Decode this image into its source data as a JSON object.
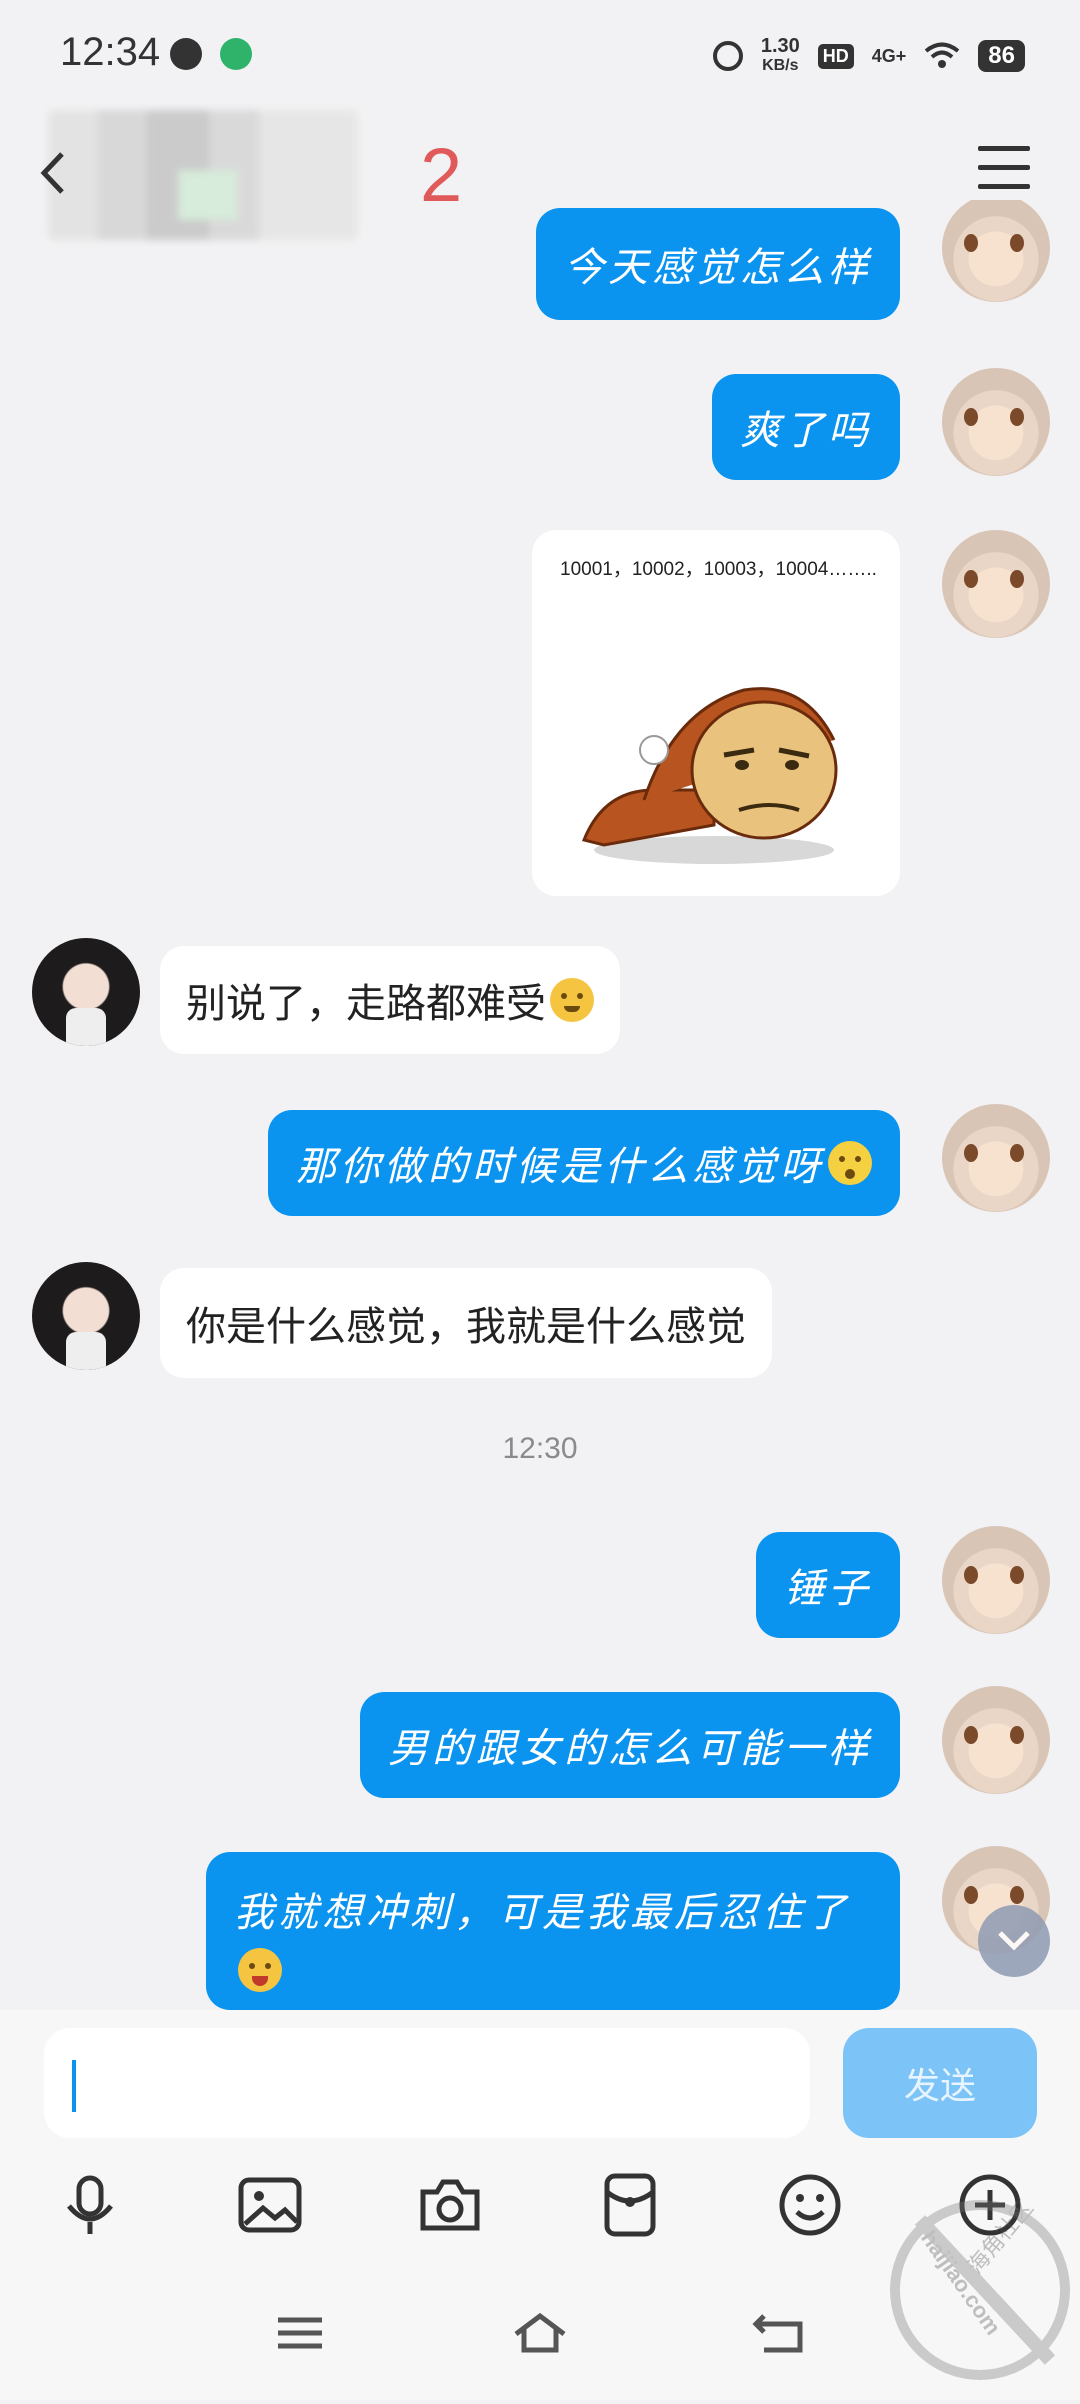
{
  "status_bar": {
    "time": "12:34",
    "net_speed_value": "1.30",
    "net_speed_unit": "KB/s",
    "hd_label": "HD",
    "signal_label": "4G+",
    "battery": "86"
  },
  "header": {
    "title_count": "2"
  },
  "messages": [
    {
      "from": "me",
      "text": "今天感觉怎么样"
    },
    {
      "from": "me",
      "text": "爽了吗"
    },
    {
      "from": "me",
      "type": "sticker",
      "sticker_text": "10001，10002，10003，10004…….."
    },
    {
      "from": "them",
      "text": "别说了，走路都难受"
    },
    {
      "from": "me",
      "text": "那你做的时候是什么感觉呀"
    },
    {
      "from": "them",
      "text": "你是什么感觉，我就是什么感觉"
    },
    {
      "type": "timestamp",
      "text": "12:30"
    },
    {
      "from": "me",
      "text": "锤子"
    },
    {
      "from": "me",
      "text": "男的跟女的怎么可能一样"
    },
    {
      "from": "me",
      "text": "我就想冲刺，可是我最后忍住了"
    }
  ],
  "input": {
    "value": "",
    "send_label": "发送"
  },
  "toolbar": [
    "microphone-icon",
    "image-icon",
    "camera-icon",
    "red-packet-icon",
    "emoji-icon",
    "plus-icon"
  ],
  "watermark": {
    "text": "haijiao.com",
    "brand": "海角社区"
  },
  "colors": {
    "outgoing_bubble": "#0b93f0",
    "send_button": "#7cc3f8",
    "title_count": "#e05a5a"
  }
}
